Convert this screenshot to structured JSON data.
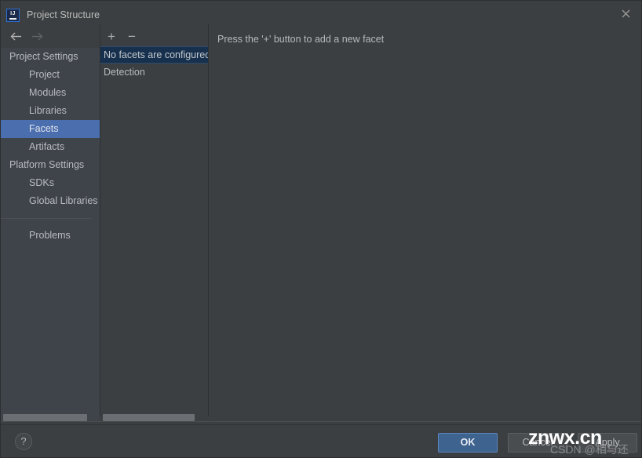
{
  "window": {
    "title": "Project Structure",
    "app_icon": "intellij-idea-icon",
    "app_icon_text": "IJ",
    "close_icon": "close-icon"
  },
  "navigation": {
    "back_icon": "arrow-left-icon",
    "forward_icon": "arrow-right-icon"
  },
  "sidebar": {
    "items": [
      {
        "label": "Project Settings",
        "type": "group",
        "selected": false
      },
      {
        "label": "Project",
        "type": "child",
        "selected": false
      },
      {
        "label": "Modules",
        "type": "child",
        "selected": false
      },
      {
        "label": "Libraries",
        "type": "child",
        "selected": false
      },
      {
        "label": "Facets",
        "type": "child",
        "selected": true
      },
      {
        "label": "Artifacts",
        "type": "child",
        "selected": false
      },
      {
        "label": "Platform Settings",
        "type": "group",
        "selected": false
      },
      {
        "label": "SDKs",
        "type": "child",
        "selected": false
      },
      {
        "label": "Global Libraries",
        "type": "child",
        "selected": false
      }
    ],
    "after_separator": [
      {
        "label": "Problems",
        "type": "child",
        "selected": false
      }
    ]
  },
  "facet_panel": {
    "toolbar": {
      "add_label": "+",
      "add_icon": "plus-icon",
      "remove_label": "−",
      "remove_icon": "minus-icon"
    },
    "rows": [
      {
        "label": "No facets are configured",
        "selected": true
      },
      {
        "label": "Detection",
        "selected": false
      }
    ]
  },
  "detail_panel": {
    "hint": "Press the '+' button to add a new facet"
  },
  "bottom_bar": {
    "help_label": "?",
    "help_icon": "question-mark-icon",
    "ok_label": "OK",
    "cancel_label": "Cancel",
    "apply_label": "Apply"
  },
  "watermark": {
    "main": "znwx.cn",
    "sub": "CSDN @相与还"
  },
  "colors": {
    "window_bg": "#3c3f41",
    "sidebar_bg": "#3f434a",
    "selection_blue": "#4b6eaf",
    "row_selection_navy": "#16304d",
    "ok_button": "#3f638f",
    "text": "#b9bcc0"
  }
}
